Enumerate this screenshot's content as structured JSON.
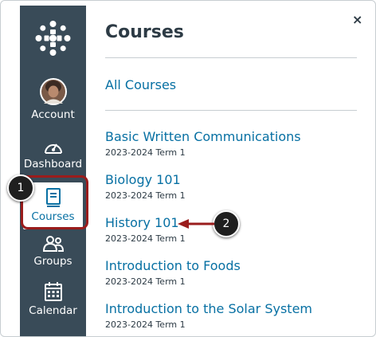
{
  "panel": {
    "title": "Courses",
    "close_glyph": "×",
    "all_courses": "All Courses",
    "courses": [
      {
        "name": "Basic Written Communications",
        "term": "2023-2024 Term 1"
      },
      {
        "name": "Biology 101",
        "term": "2023-2024 Term 1"
      },
      {
        "name": "History 101",
        "term": "2023-2024 Term 1"
      },
      {
        "name": "Introduction to Foods",
        "term": "2023-2024 Term 1"
      },
      {
        "name": "Introduction to the Solar System",
        "term": "2023-2024 Term 1"
      }
    ]
  },
  "nav": {
    "items": [
      {
        "label": "Account",
        "icon": "avatar"
      },
      {
        "label": "Dashboard",
        "icon": "speedometer-icon"
      },
      {
        "label": "Courses",
        "icon": "book-icon",
        "active": true
      },
      {
        "label": "Groups",
        "icon": "people-icon"
      },
      {
        "label": "Calendar",
        "icon": "calendar-icon"
      }
    ]
  },
  "callouts": {
    "one": "1",
    "two": "2"
  },
  "colors": {
    "nav_bg": "#394b58",
    "link": "#0770a3",
    "highlight": "#9a1c1c",
    "text": "#2d3b45"
  }
}
